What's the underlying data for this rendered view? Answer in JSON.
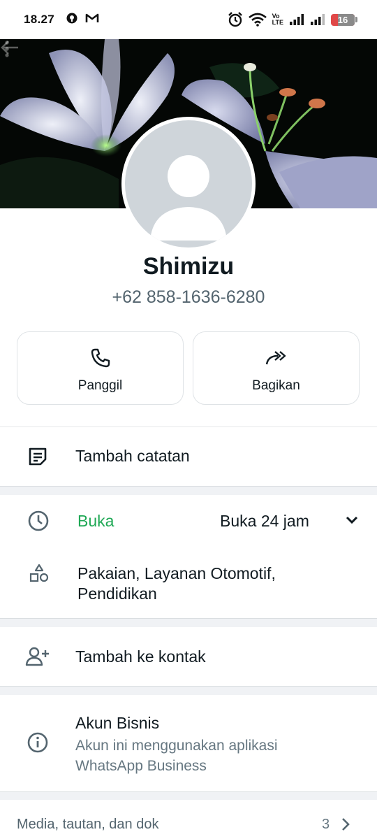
{
  "status_bar": {
    "time": "18.27",
    "network_label": "Vo\nLTE",
    "battery_level": "16",
    "icons": [
      "location-icon",
      "gmail-icon",
      "alarm-icon",
      "wifi-icon",
      "signal-icon"
    ]
  },
  "profile": {
    "name": "Shimizu",
    "phone": "+62 858-1636-6280"
  },
  "actions": {
    "call_label": "Panggil",
    "share_label": "Bagikan"
  },
  "notes": {
    "add_note_label": "Tambah catatan"
  },
  "business_hours": {
    "status_label": "Buka",
    "hours_label": "Buka 24 jam",
    "status_color": "#1fa855"
  },
  "categories": {
    "line1": "Pakaian, Layanan Otomotif,",
    "line2": "Pendidikan"
  },
  "contact": {
    "add_contact_label": "Tambah ke kontak"
  },
  "business_account": {
    "title": "Akun Bisnis",
    "desc_line1": "Akun ini menggunakan aplikasi",
    "desc_line2": "WhatsApp Business"
  },
  "media": {
    "label": "Media, tautan, dan dok",
    "count": "3"
  }
}
